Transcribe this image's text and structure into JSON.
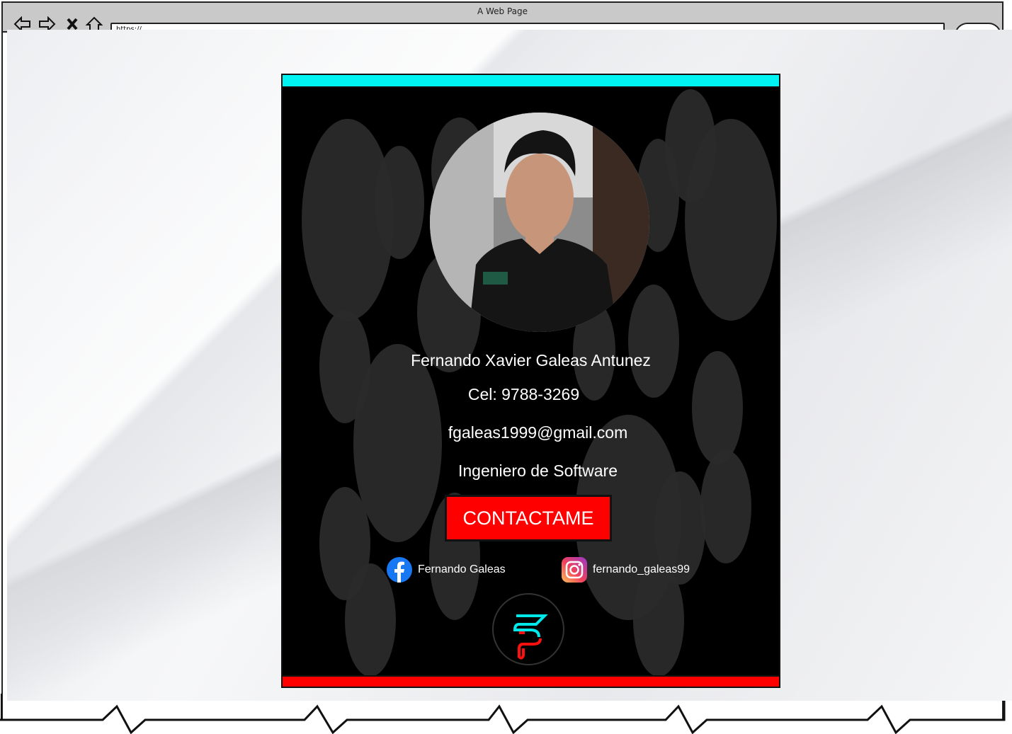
{
  "window": {
    "title": "A Web Page",
    "url": "https://"
  },
  "profile": {
    "name": "Fernando Xavier Galeas Antunez",
    "phone": "Cel: 9788-3269",
    "email": "fgaleas1999@gmail.com",
    "role": "Ingeniero de Software",
    "contact_button": "CONTACTAME"
  },
  "social": {
    "facebook": {
      "label": "Fernando Galeas",
      "icon": "facebook-icon",
      "color": "#1877F2"
    },
    "instagram": {
      "label": "fernando_galeas99",
      "icon": "instagram-icon"
    }
  },
  "colors": {
    "accent_top": "#00f3f3",
    "accent_bottom": "#ff0000",
    "card_background": "#000000",
    "button": "#ff0000"
  }
}
